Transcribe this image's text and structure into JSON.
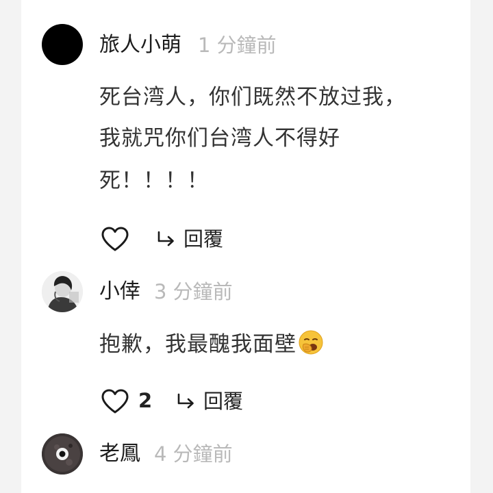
{
  "comments": [
    {
      "username": "旅人小萌",
      "time": "1 分鐘前",
      "lines": [
        "死台湾人，你们既然不放过我，",
        "我就咒你们台湾人不得好",
        "死！！！！"
      ],
      "likes": "",
      "reply_label": "回覆",
      "avatar": "black-circle"
    },
    {
      "username": "小倖",
      "time": "3 分鐘前",
      "lines": [
        "抱歉，我最醜我面壁"
      ],
      "emoji": "yawning-face-emoji",
      "likes": "2",
      "reply_label": "回覆",
      "avatar": "grayscale-photo"
    },
    {
      "username": "老鳳",
      "time": "4 分鐘前",
      "avatar": "eye-planet"
    }
  ],
  "colors": {
    "background": "#f3f3f3",
    "panel": "#ffffff",
    "time_text": "#b9b9b9",
    "body_text": "#333333"
  }
}
